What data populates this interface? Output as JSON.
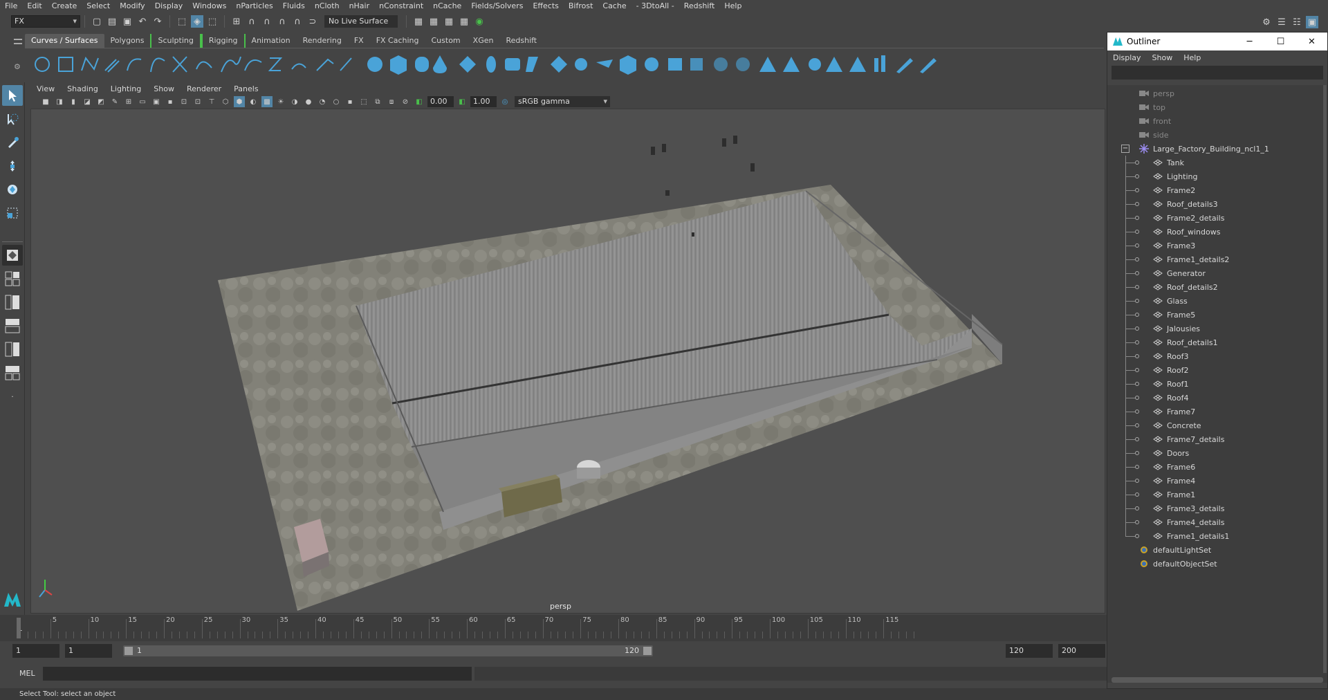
{
  "menubar": [
    "File",
    "Edit",
    "Create",
    "Select",
    "Modify",
    "Display",
    "Windows",
    "nParticles",
    "Fluids",
    "nCloth",
    "nHair",
    "nConstraint",
    "nCache",
    "Fields/Solvers",
    "Effects",
    "Bifrost",
    "Cache",
    "- 3DtoAll -",
    "Redshift",
    "Help"
  ],
  "statusline": {
    "menuset": "FX",
    "live_surface": "No Live Surface"
  },
  "shelf_tabs": [
    "Curves / Surfaces",
    "Polygons",
    "Sculpting",
    "Rigging",
    "Animation",
    "Rendering",
    "FX",
    "FX Caching",
    "Custom",
    "XGen",
    "Redshift"
  ],
  "shelf_active": "Curves / Surfaces",
  "panel_menu": [
    "View",
    "Shading",
    "Lighting",
    "Show",
    "Renderer",
    "Panels"
  ],
  "panel_toolbar": {
    "exposure": "0.00",
    "gamma": "1.00",
    "color_space": "sRGB gamma"
  },
  "viewport": {
    "camera": "persp"
  },
  "timeline": {
    "ticks": [
      5,
      10,
      15,
      20,
      25,
      30,
      35,
      40,
      45,
      50,
      55,
      60,
      65,
      70,
      75,
      80,
      85,
      90,
      95,
      100,
      105,
      110,
      115
    ],
    "current_frame": "1"
  },
  "range": {
    "start": "1",
    "playback_start": "1",
    "slider_start": "1",
    "slider_end": "120",
    "playback_end": "120",
    "end": "200"
  },
  "cmdline": {
    "label": "MEL"
  },
  "helpline": "Select Tool: select an object",
  "outliner": {
    "title": "Outliner",
    "menu": [
      "Display",
      "Show",
      "Help"
    ],
    "cameras": [
      "persp",
      "top",
      "front",
      "side"
    ],
    "group": "Large_Factory_Building_ncl1_1",
    "children": [
      "Tank",
      "Lighting",
      "Frame2",
      "Roof_details3",
      "Frame2_details",
      "Roof_windows",
      "Frame3",
      "Frame1_details2",
      "Generator",
      "Roof_details2",
      "Glass",
      "Frame5",
      "Jalousies",
      "Roof_details1",
      "Roof3",
      "Roof2",
      "Roof1",
      "Roof4",
      "Frame7",
      "Concrete",
      "Frame7_details",
      "Doors",
      "Frame6",
      "Frame4",
      "Frame1",
      "Frame3_details",
      "Frame4_details",
      "Frame1_details1"
    ],
    "sets": [
      "defaultLightSet",
      "defaultObjectSet"
    ]
  },
  "colors": {
    "accent": "#5285a6",
    "shelf_icon": "#4aa3d8",
    "bracket": "#49c04b"
  }
}
